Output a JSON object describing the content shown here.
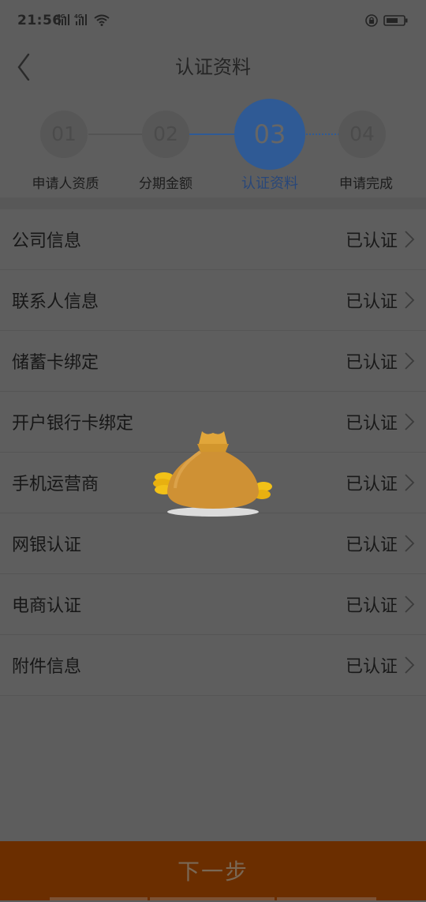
{
  "status_bar": {
    "time": "21:56",
    "network_1": "4G",
    "network_2": "4G"
  },
  "navbar": {
    "back_icon": "chevron-left-icon",
    "title": "认证资料"
  },
  "stepper": {
    "steps": [
      {
        "number": "01",
        "label": "申请人资质"
      },
      {
        "number": "02",
        "label": "分期金额"
      },
      {
        "number": "03",
        "label": "认证资料"
      },
      {
        "number": "04",
        "label": "申请完成"
      }
    ],
    "current_step": 3
  },
  "items": [
    {
      "label": "公司信息",
      "status": "已认证"
    },
    {
      "label": "联系人信息",
      "status": "已认证"
    },
    {
      "label": "储蓄卡绑定",
      "status": "已认证"
    },
    {
      "label": "开户银行卡绑定",
      "status": "已认证"
    },
    {
      "label": "手机运营商",
      "status": "已认证"
    },
    {
      "label": "网银认证",
      "status": "已认证"
    },
    {
      "label": "电商认证",
      "status": "已认证"
    },
    {
      "label": "附件信息",
      "status": "已认证"
    }
  ],
  "next_button": {
    "label": "下一步"
  },
  "colors": {
    "accent": "#2f5a95",
    "button": "#6b2e00",
    "overlay_background": "#5d5d5d"
  },
  "loading_icon": "money-bag-icon"
}
